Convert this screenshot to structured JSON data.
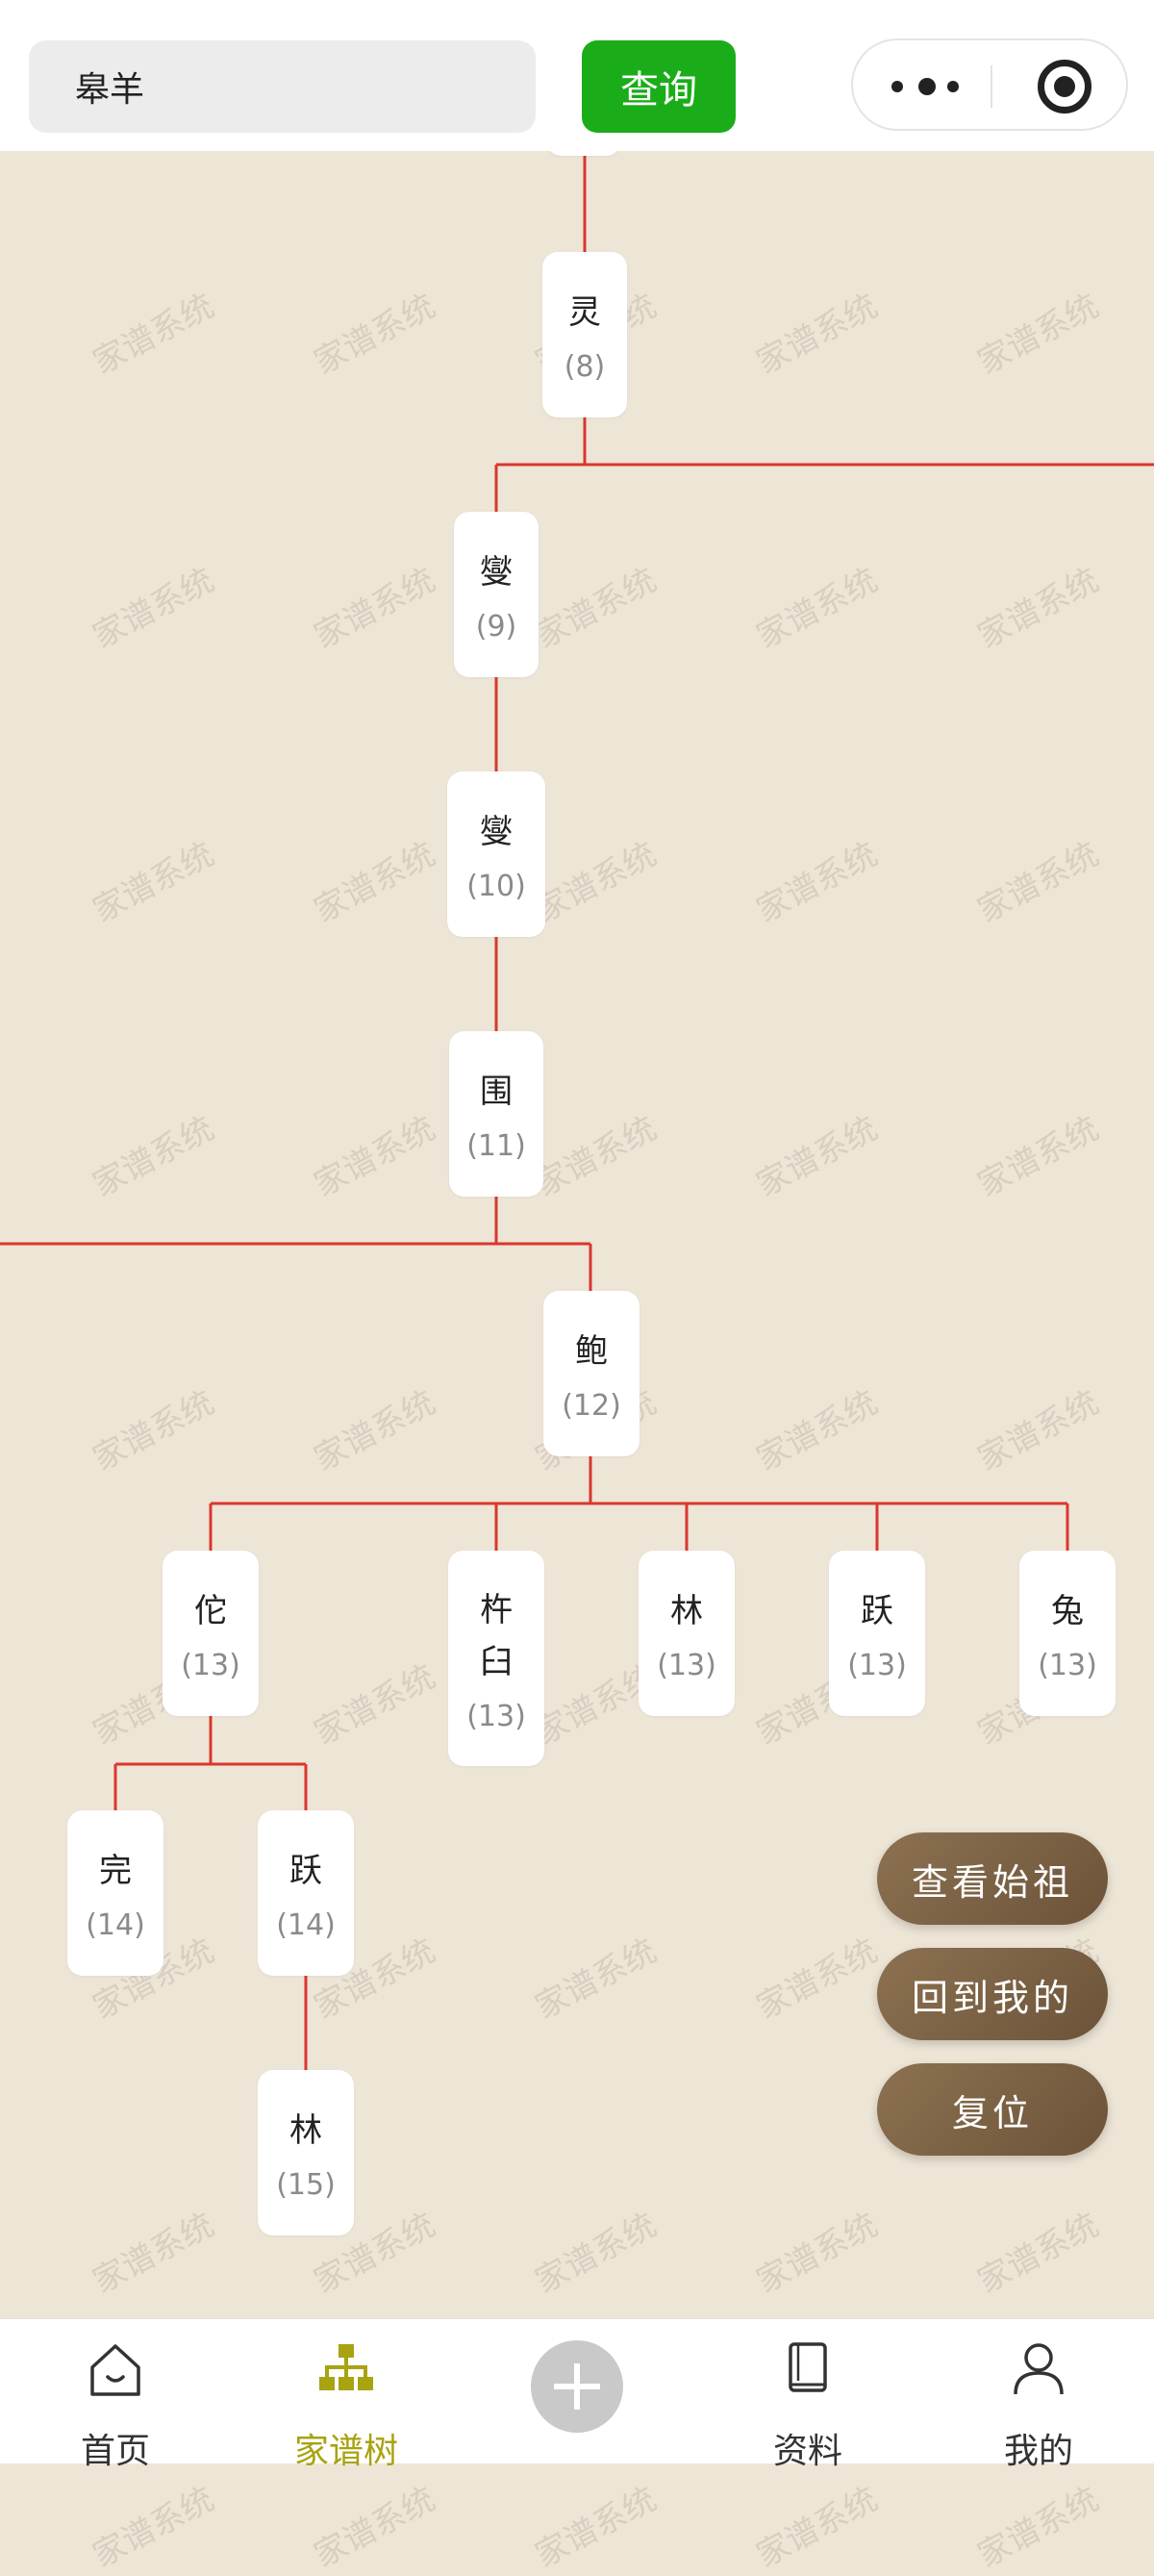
{
  "search": {
    "value": "皋羊",
    "button": "查询"
  },
  "watermark": "家谱系统",
  "tree": {
    "nodes": [
      {
        "id": "n8",
        "name": "灵",
        "gen": "(8)"
      },
      {
        "id": "n9",
        "name": "燮",
        "gen": "(9)"
      },
      {
        "id": "n10",
        "name": "燮",
        "gen": "(10)"
      },
      {
        "id": "n11",
        "name": "围",
        "gen": "(11)"
      },
      {
        "id": "n12",
        "name": "鲍",
        "gen": "(12)"
      },
      {
        "id": "n13a",
        "name": "佗",
        "gen": "(13)"
      },
      {
        "id": "n13b",
        "name": "杵\n臼",
        "gen": "(13)"
      },
      {
        "id": "n13c",
        "name": "林",
        "gen": "(13)"
      },
      {
        "id": "n13d",
        "name": "跃",
        "gen": "(13)"
      },
      {
        "id": "n13e",
        "name": "兔",
        "gen": "(13)"
      },
      {
        "id": "n14a",
        "name": "完",
        "gen": "(14)"
      },
      {
        "id": "n14b",
        "name": "跃",
        "gen": "(14)"
      },
      {
        "id": "n15",
        "name": "林",
        "gen": "(15)"
      }
    ],
    "line_color": "#d9372f"
  },
  "floating_buttons": {
    "view_ancestor": "查看始祖",
    "back_to_me": "回到我的",
    "reset": "复位"
  },
  "tabbar": {
    "home": "首页",
    "family_tree": "家谱树",
    "materials": "资料",
    "mine": "我的",
    "active_color": "#a8a310"
  }
}
